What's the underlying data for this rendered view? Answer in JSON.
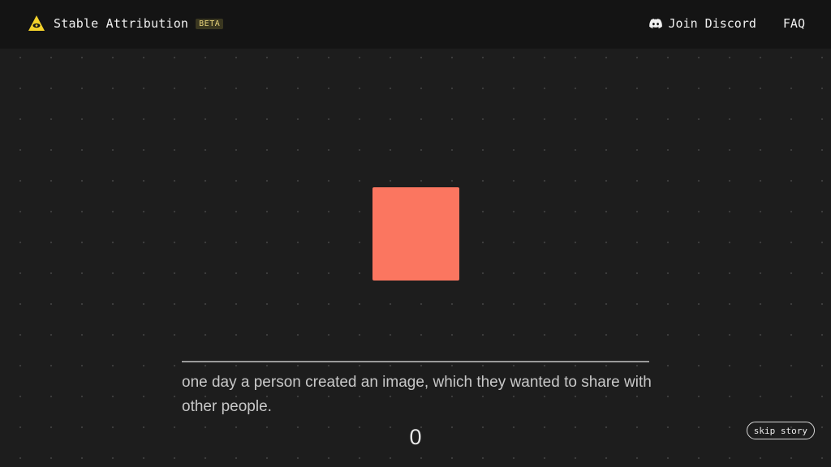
{
  "header": {
    "logo_icon": "eye-triangle-icon",
    "brand_name": "Stable Attribution",
    "badge": "BETA",
    "nav": [
      {
        "label": "Join Discord",
        "icon": "discord-icon"
      },
      {
        "label": "FAQ"
      }
    ]
  },
  "colors": {
    "background": "#1d1d1d",
    "header": "#141414",
    "square": "#fb7660",
    "logo_yellow": "#f3d12b",
    "badge_text": "#e6d27a"
  },
  "story": {
    "text": "one day a person created an image, which they wanted to share with other people.",
    "counter": "0",
    "skip_label": "skip story"
  }
}
